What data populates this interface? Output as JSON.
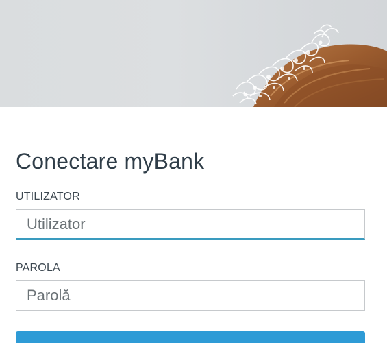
{
  "login": {
    "title": "Conectare myBank",
    "username": {
      "label": "UTILIZATOR",
      "placeholder": "Utilizator",
      "value": ""
    },
    "password": {
      "label": "PAROLA",
      "placeholder": "Parolă",
      "value": ""
    },
    "submit_label": ""
  },
  "colors": {
    "accent": "#3a9bbf",
    "button": "#2e9bd6",
    "text": "#2f3d48"
  }
}
